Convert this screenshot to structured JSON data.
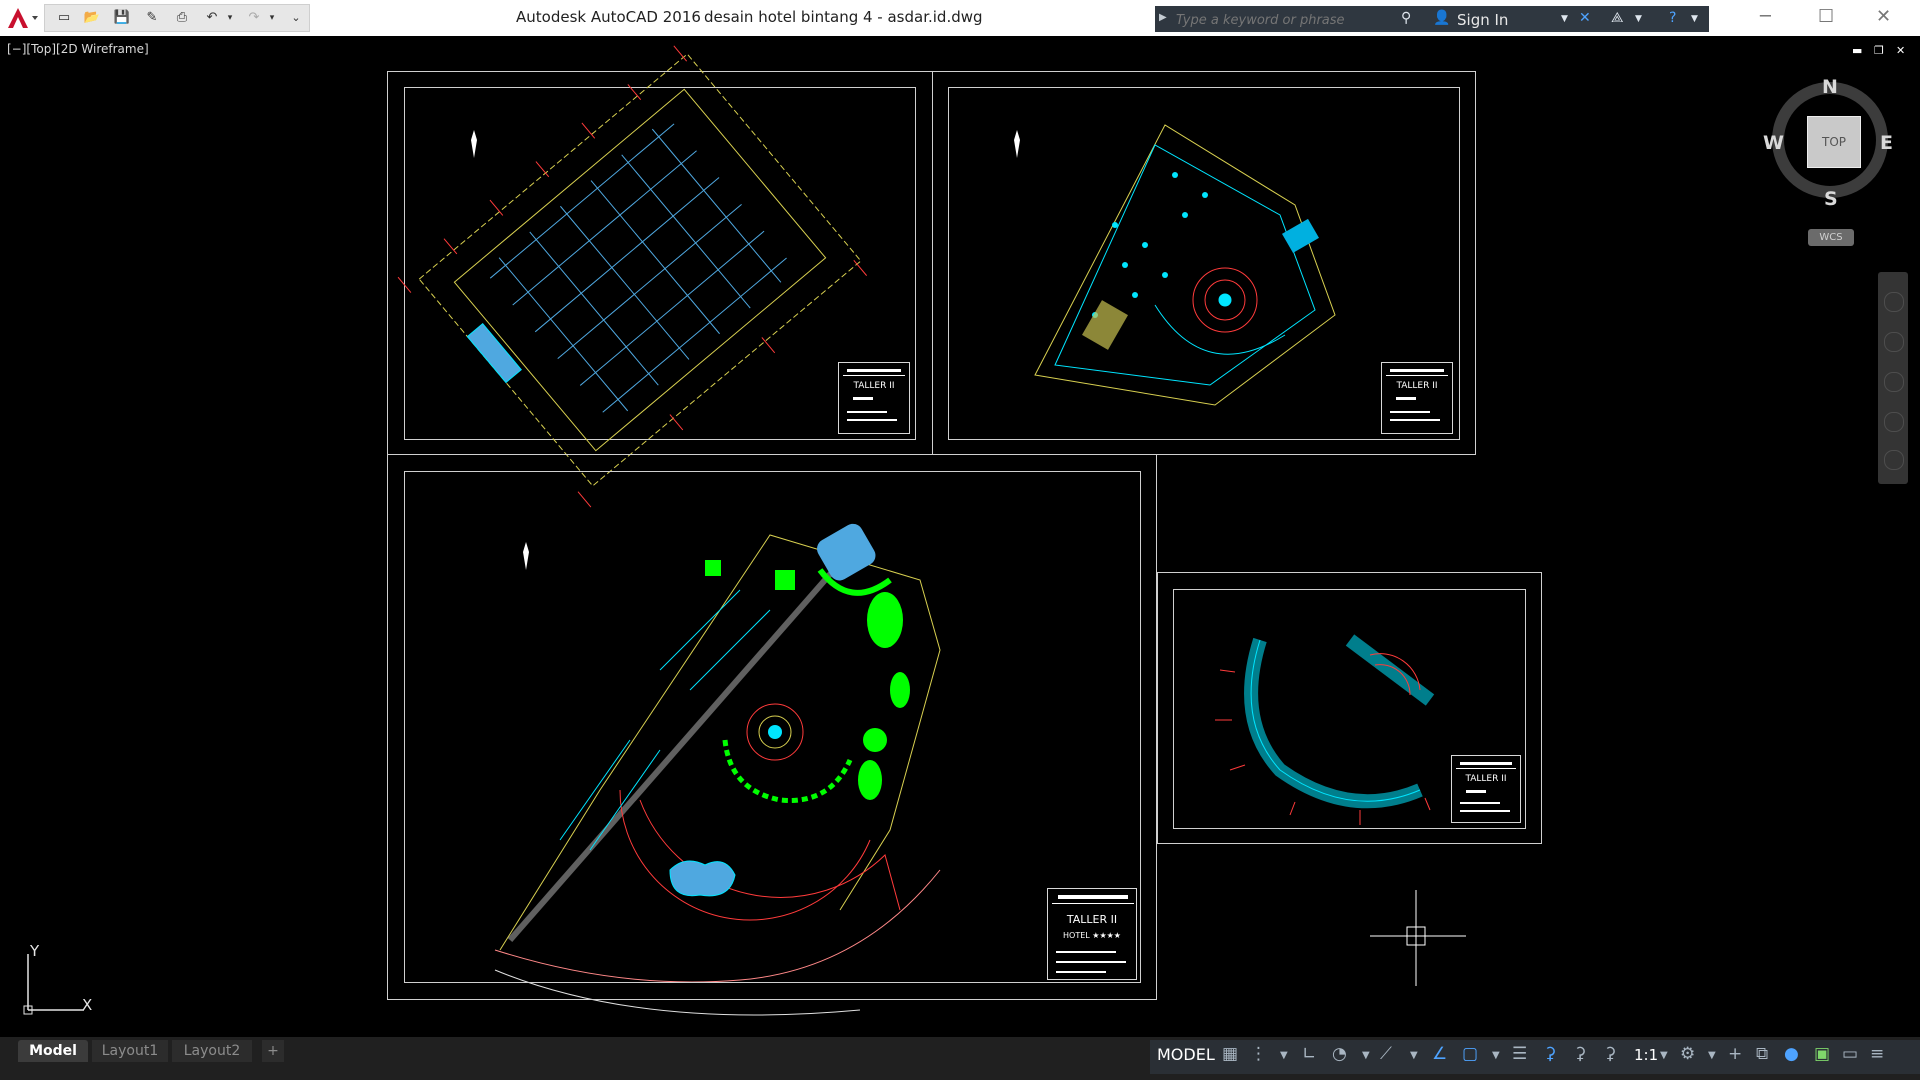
{
  "app": {
    "title": "Autodesk AutoCAD 2016",
    "document": "desain hotel bintang 4 - asdar.id.dwg"
  },
  "search": {
    "placeholder": "Type a keyword or phrase"
  },
  "infocenter": {
    "sign_in_label": "Sign In"
  },
  "viewport": {
    "label": "[−][Top][2D Wireframe]"
  },
  "viewcube": {
    "north": "N",
    "south": "S",
    "east": "E",
    "west": "W",
    "face": "TOP",
    "ucs_menu": "WCS"
  },
  "ucs_icon": {
    "x_label": "X",
    "y_label": "Y"
  },
  "drawings": {
    "sheet1": {
      "tb_title": "TALLER II"
    },
    "sheet2": {
      "tb_title": "TALLER II"
    },
    "sheet3": {
      "tb_title": "TALLER II",
      "tb_sub": "HOTEL ★★★★"
    },
    "sheet4": {
      "tb_title": "TALLER II"
    }
  },
  "layout_tabs": [
    {
      "label": "Model",
      "active": true
    },
    {
      "label": "Layout1",
      "active": false
    },
    {
      "label": "Layout2",
      "active": false
    },
    {
      "label": "+",
      "active": false
    }
  ],
  "status": {
    "model_label": "MODEL",
    "annotation_scale": "1:1"
  },
  "colors": {
    "cad_cyan": "#00e5ff",
    "cad_green": "#00ff00",
    "cad_red": "#ff3b3b",
    "cad_yellow": "#d8d050",
    "accent_blue": "#2f7cd6"
  }
}
